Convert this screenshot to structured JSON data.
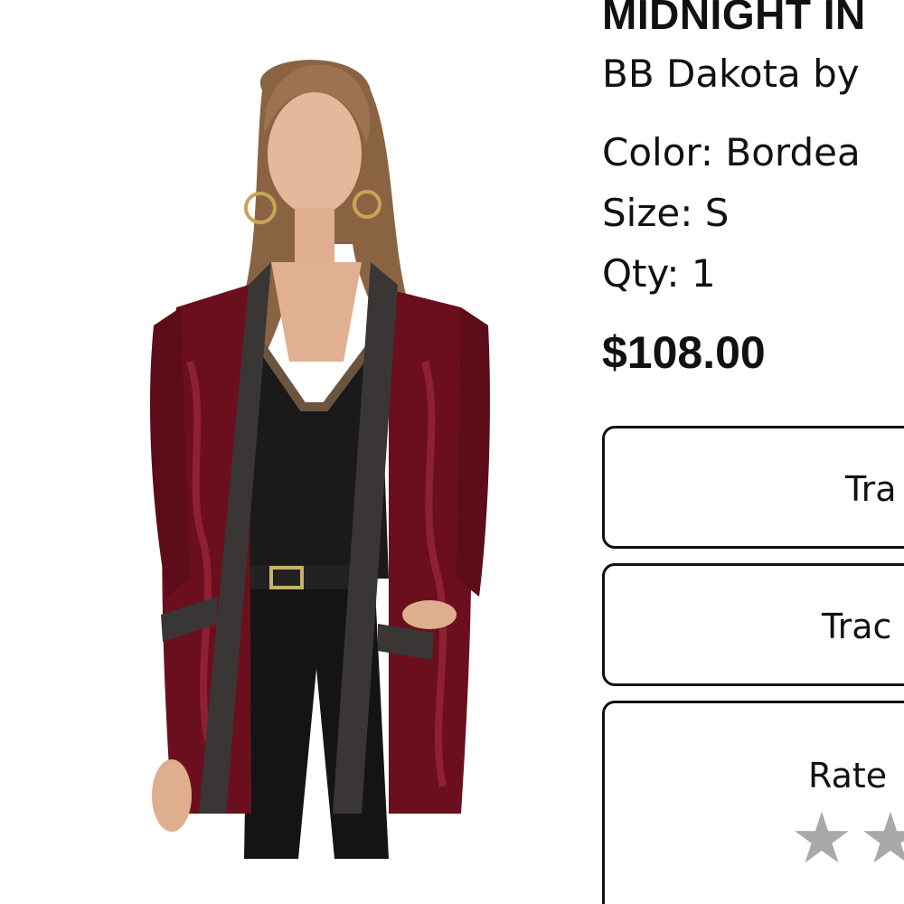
{
  "product": {
    "name": "MIDNIGHT IN",
    "brand": "BB Dakota by",
    "color": "Color: Bordea",
    "size": "Size: S",
    "qty": "Qty: 1",
    "price": "$108.00"
  },
  "actions": {
    "track_button_1": "Tra",
    "track_button_2": "Trac",
    "rate_label": "Rate"
  },
  "rating": {
    "stars_visible": 2,
    "star_color": "#a9a9a9"
  },
  "icons": {
    "star": "star-icon"
  }
}
